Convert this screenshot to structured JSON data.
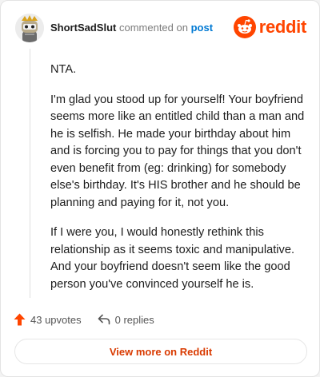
{
  "header": {
    "username": "ShortSadSlut",
    "action_text": "commented on",
    "post_link": "post",
    "logo_text": "reddit"
  },
  "comment": {
    "paragraphs": [
      "NTA.",
      "I'm glad you stood up for yourself! Your boyfriend seems more like an entitled child than a man and he is selfish. He made your birthday about him and is forcing you to pay for things that you don't even benefit from (eg: drinking) for somebody else's birthday. It's HIS brother and he should be planning and paying for it, not you.",
      "If I were you, I would honestly rethink this relationship as it seems toxic and manipulative. And your boyfriend doesn't seem like the good person you've convinced yourself he is."
    ]
  },
  "footer": {
    "upvotes": "43 upvotes",
    "replies": "0 replies",
    "view_more": "View more on Reddit"
  },
  "colors": {
    "brand": "#ff4500",
    "link": "#0079d3",
    "view_more_text": "#d93a00"
  },
  "icons": {
    "avatar": "snoo-avatar-icon",
    "logo": "reddit-snoo-icon",
    "upvote": "upvote-arrow-icon",
    "reply": "reply-arrow-icon"
  }
}
